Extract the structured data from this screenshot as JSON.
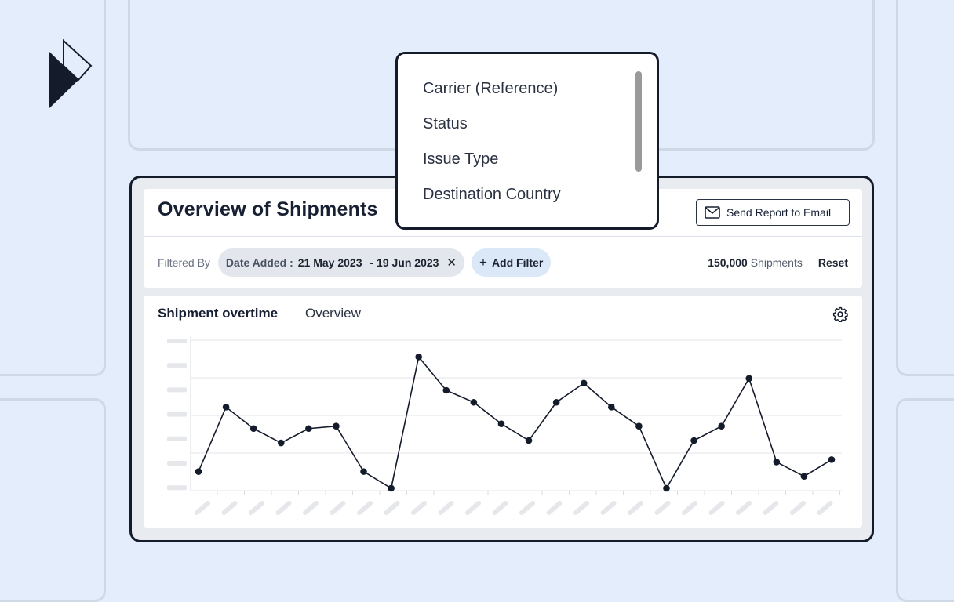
{
  "header": {
    "title": "Overview of Shipments",
    "send_report_label": "Send Report to Email"
  },
  "filters": {
    "filtered_by_label": "Filtered By",
    "date_filter": {
      "field": "Date Added :",
      "start": "21 May 2023",
      "end": "- 19 Jun 2023"
    },
    "add_filter_label": "Add Filter",
    "shipment_count": "150,000",
    "shipment_unit": "Shipments",
    "reset_label": "Reset"
  },
  "dropdown": {
    "items": [
      "Carrier (Reference)",
      "Status",
      "Issue Type",
      "Destination Country"
    ]
  },
  "chart_tabs": {
    "active": "Shipment overtime",
    "other": "Overview"
  },
  "icons": {
    "logo": "brand-logo-icon",
    "mail": "mail-icon",
    "close": "close-icon",
    "plus": "plus-icon",
    "settings": "gear-icon"
  },
  "colors": {
    "background": "#e3edfb",
    "accent_dark": "#141b2b",
    "add_filter_bg": "#dbe8f8",
    "line": "#141b2b"
  },
  "chart_data": {
    "type": "line",
    "title": "",
    "xlabel": "",
    "ylabel": "",
    "ylim": [
      0,
      6.3
    ],
    "grid": true,
    "series": [
      {
        "values": [
          0.8,
          3.5,
          2.6,
          2.0,
          2.6,
          2.7,
          0.8,
          0.1,
          5.6,
          4.2,
          3.7,
          2.8,
          2.1,
          3.7,
          4.5,
          3.5,
          2.7,
          0.1,
          2.1,
          2.7,
          4.7,
          1.2,
          0.6,
          1.3
        ]
      }
    ]
  }
}
